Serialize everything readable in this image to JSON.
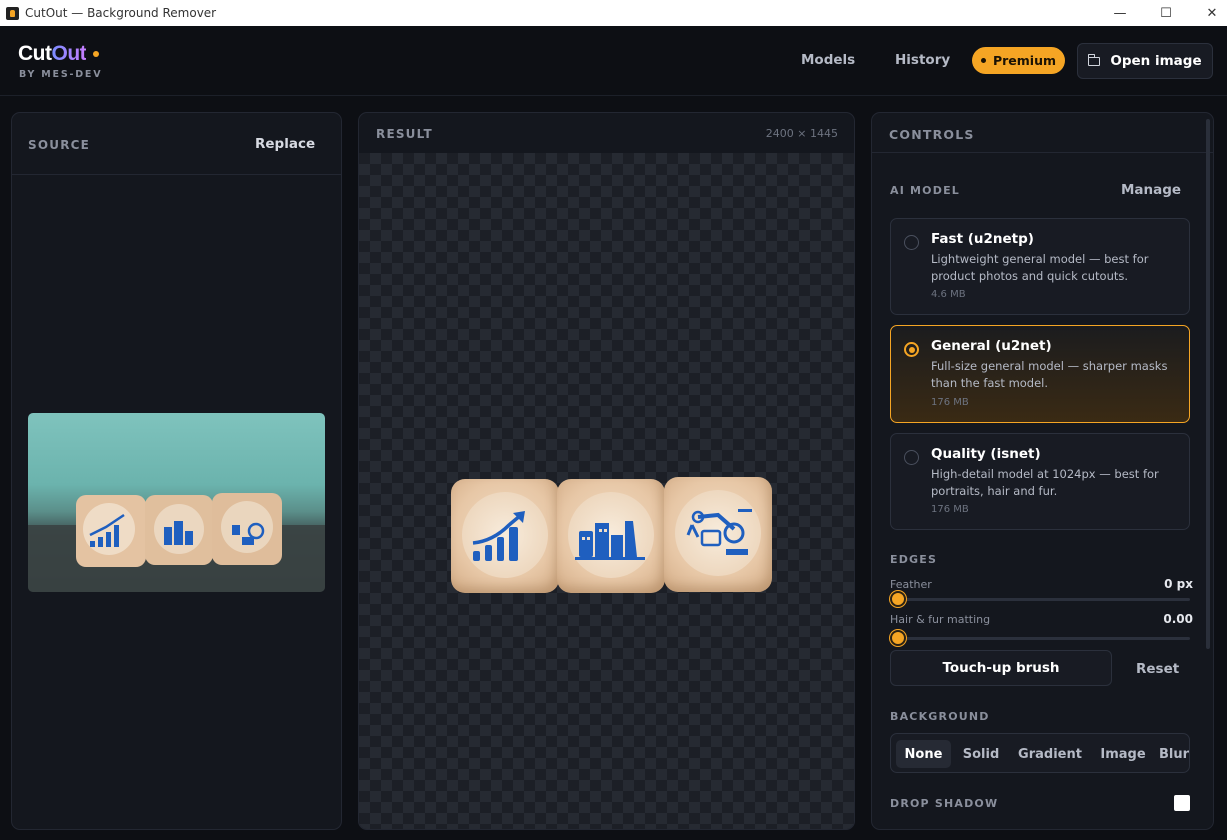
{
  "window": {
    "title": "CutOut — Background Remover",
    "minimize": "—",
    "maximize": "☐",
    "close": "✕"
  },
  "header": {
    "logo_cut": "Cut",
    "logo_out": "Out",
    "byline": "BY MES-DEV",
    "nav": {
      "models": "Models",
      "history": "History"
    },
    "premium": "Premium",
    "open_image": "Open image"
  },
  "source": {
    "label": "SOURCE",
    "replace": "Replace"
  },
  "result": {
    "label": "RESULT",
    "dimensions": "2400 × 1445"
  },
  "controls": {
    "label": "CONTROLS",
    "ai_model": {
      "label": "AI MODEL",
      "manage": "Manage",
      "selected": 1,
      "models": [
        {
          "name": "Fast (u2netp)",
          "desc": "Lightweight general model — best for product photos and quick cutouts.",
          "size": "4.6 MB"
        },
        {
          "name": "General (u2net)",
          "desc": "Full-size general model — sharper masks than the fast model.",
          "size": "176 MB"
        },
        {
          "name": "Quality (isnet)",
          "desc": "High-detail model at 1024px — best for portraits, hair and fur.",
          "size": "176 MB"
        }
      ]
    },
    "edges": {
      "label": "EDGES",
      "feather": {
        "label": "Feather",
        "value": "0 px",
        "fraction": 0
      },
      "matting": {
        "label": "Hair & fur matting",
        "value": "0.00",
        "fraction": 0
      },
      "touchup": "Touch-up brush",
      "reset": "Reset"
    },
    "background": {
      "label": "BACKGROUND",
      "options": [
        "None",
        "Solid",
        "Gradient",
        "Image",
        "Blur"
      ],
      "selected": "None"
    },
    "drop_shadow": {
      "label": "DROP SHADOW",
      "checked": false
    }
  },
  "colors": {
    "accent": "#f5a524",
    "panel": "#14171e",
    "background": "#0d0f14",
    "logo_gradient": [
      "#7b8cff",
      "#c77dff"
    ]
  }
}
